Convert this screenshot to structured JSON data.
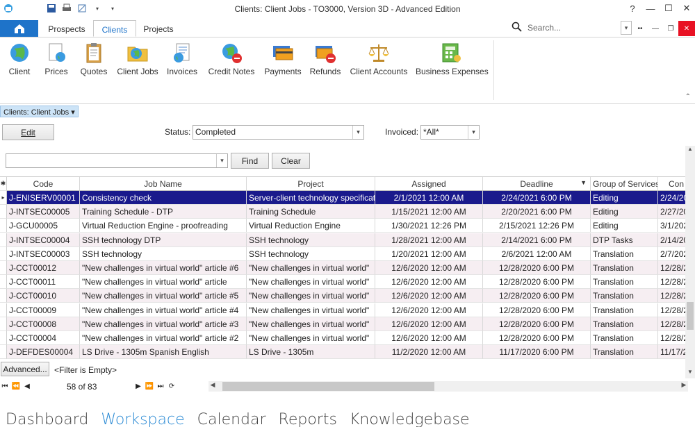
{
  "window": {
    "title": "Clients: Client Jobs - TO3000, Version 3D - Advanced Edition",
    "help_label": "?",
    "minimize_label": "—",
    "maximize_label": "☐",
    "close_label": "✕"
  },
  "ribbon_tabs": [
    {
      "label": "Prospects"
    },
    {
      "label": "Clients"
    },
    {
      "label": "Projects"
    }
  ],
  "search": {
    "placeholder": "Search..."
  },
  "ribbon_buttons": [
    {
      "label": "Client",
      "icon": "globe-icon"
    },
    {
      "label": "Prices",
      "icon": "prices-icon"
    },
    {
      "label": "Quotes",
      "icon": "clipboard-icon"
    },
    {
      "label": "Client Jobs",
      "icon": "folder-globe-icon"
    },
    {
      "label": "Invoices",
      "icon": "invoice-icon"
    },
    {
      "label": "Credit Notes",
      "icon": "credit-note-icon"
    },
    {
      "label": "Payments",
      "icon": "payment-card-icon"
    },
    {
      "label": "Refunds",
      "icon": "refund-card-icon"
    },
    {
      "label": "Client Accounts",
      "icon": "scales-icon"
    },
    {
      "label": "Business Expenses",
      "icon": "expenses-icon"
    }
  ],
  "breadcrumb": "Clients: Client Jobs ▾",
  "toolbar": {
    "edit_label": "Edit",
    "status_label": "Status:",
    "status_value": "Completed",
    "invoiced_label": "Invoiced:",
    "invoiced_value": "*All*",
    "find_label": "Find",
    "clear_label": "Clear"
  },
  "grid": {
    "columns": [
      "Code",
      "Job Name",
      "Project",
      "Assigned",
      "Deadline",
      "Group of Services",
      "Con"
    ],
    "rows": [
      [
        "J-ENISERV00001",
        "Consistency check",
        "Server-client technology specificat",
        "2/1/2021 12:00 AM",
        "2/24/2021 6:00 PM",
        "Editing",
        "2/24/20"
      ],
      [
        "J-INTSEC00005",
        "Training Schedule - DTP",
        "Training Schedule",
        "1/15/2021 12:00 AM",
        "2/20/2021 6:00 PM",
        "Editing",
        "2/27/20"
      ],
      [
        "J-GCU00005",
        "Virtual Reduction Engine - proofreading",
        "Virtual Reduction Engine",
        "1/30/2021 12:26 PM",
        "2/15/2021 12:26 PM",
        "Editing",
        "3/1/202"
      ],
      [
        "J-INTSEC00004",
        "SSH technology DTP",
        "SSH technology",
        "1/28/2021 12:00 AM",
        "2/14/2021 6:00 PM",
        "DTP Tasks",
        "2/14/20"
      ],
      [
        "J-INTSEC00003",
        "SSH technology",
        "SSH technology",
        "1/20/2021 12:00 AM",
        "2/6/2021 12:00 AM",
        "Translation",
        "2/7/202"
      ],
      [
        "J-CCT00012",
        "\"New challenges in virtual world\" article #6",
        "\"New challenges in virtual world\"",
        "12/6/2020 12:00 AM",
        "12/28/2020 6:00 PM",
        "Translation",
        "12/28/2"
      ],
      [
        "J-CCT00011",
        "\"New challenges in virtual world\" article",
        "\"New challenges in virtual world\"",
        "12/6/2020 12:00 AM",
        "12/28/2020 6:00 PM",
        "Translation",
        "12/28/2"
      ],
      [
        "J-CCT00010",
        "\"New challenges in virtual world\" article #5",
        "\"New challenges in virtual world\"",
        "12/6/2020 12:00 AM",
        "12/28/2020 6:00 PM",
        "Translation",
        "12/28/2"
      ],
      [
        "J-CCT00009",
        "\"New challenges in virtual world\" article #4",
        "\"New challenges in virtual world\"",
        "12/6/2020 12:00 AM",
        "12/28/2020 6:00 PM",
        "Translation",
        "12/28/2"
      ],
      [
        "J-CCT00008",
        "\"New challenges in virtual world\" article #3",
        "\"New challenges in virtual world\"",
        "12/6/2020 12:00 AM",
        "12/28/2020 6:00 PM",
        "Translation",
        "12/28/2"
      ],
      [
        "J-CCT00004",
        "\"New challenges in virtual world\" article #2",
        "\"New challenges in virtual world\"",
        "12/6/2020 12:00 AM",
        "12/28/2020 6:00 PM",
        "Translation",
        "12/28/2"
      ],
      [
        "J-DEFDES00004",
        "LS Drive - 1305m Spanish English",
        "LS Drive - 1305m",
        "11/2/2020 12:00 AM",
        "11/17/2020 6:00 PM",
        "Translation",
        "11/17/2"
      ]
    ]
  },
  "filter": {
    "advanced_label": "Advanced...",
    "status_text": "<Filter is Empty>"
  },
  "pager": {
    "text": "58 of 83"
  },
  "bottom_tabs": [
    {
      "label": "Dashboard"
    },
    {
      "label": "Workspace"
    },
    {
      "label": "Calendar"
    },
    {
      "label": "Reports"
    },
    {
      "label": "Knowledgebase"
    }
  ],
  "colors": {
    "accent": "#1e73c9",
    "selected_row": "#1a1a8c",
    "active_bottom_tab": "#2a8ad4"
  }
}
